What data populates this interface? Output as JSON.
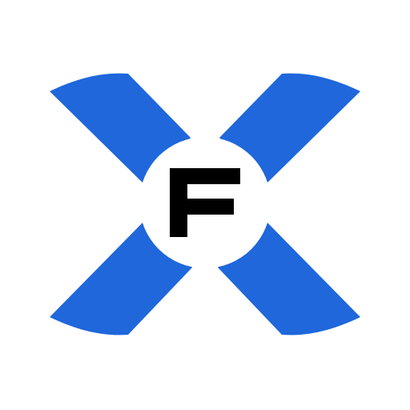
{
  "logo": {
    "letter": "F",
    "colors": {
      "x_blue": "#1F67DB",
      "letter_black": "#000000",
      "center_white": "#FFFFFF",
      "background": "#FFFFFF"
    },
    "icon_name": "x-logo-with-f-letter"
  }
}
